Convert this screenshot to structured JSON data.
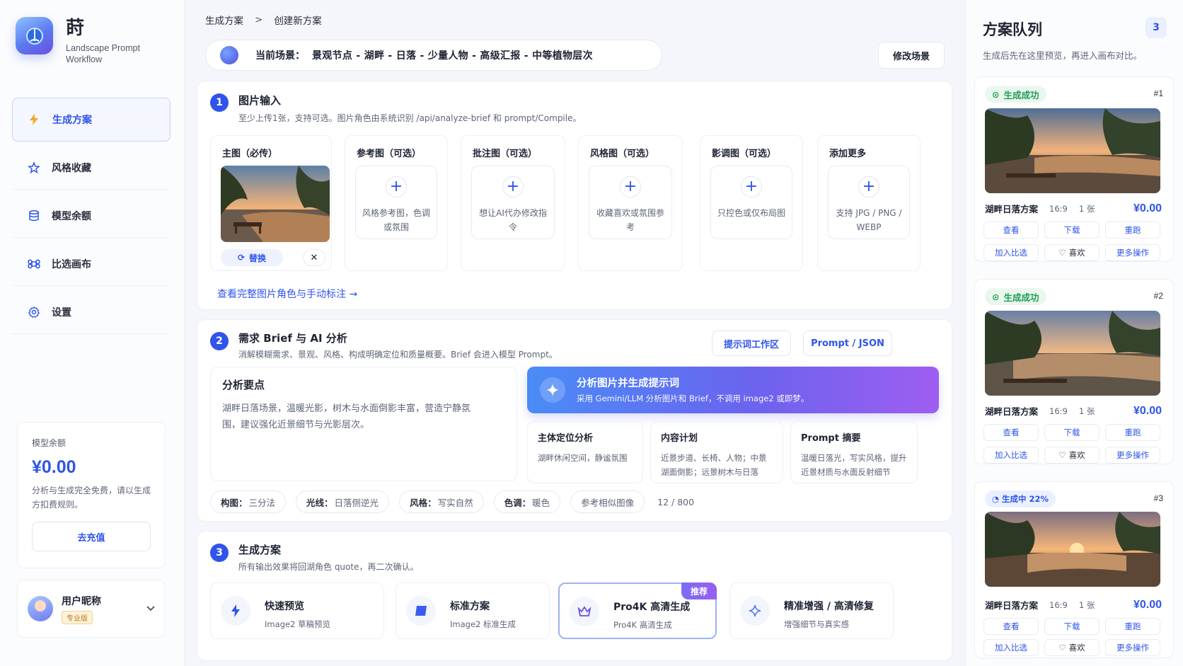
{
  "brand": {
    "title": "莳",
    "subtitle": "Landscape Prompt Workflow"
  },
  "nav": [
    {
      "label": "生成方案",
      "icon": "lightning-icon",
      "active": true
    },
    {
      "label": "风格收藏",
      "icon": "star-icon"
    },
    {
      "label": "模型余额",
      "icon": "database-icon"
    },
    {
      "label": "比选画布",
      "icon": "command-icon"
    },
    {
      "label": "设置",
      "icon": "gear-icon"
    }
  ],
  "balance": {
    "label": "模型余额",
    "value": "¥0.00",
    "note": "分析与生成完全免费，请以生成方扣费规则。",
    "recharge": "去充值"
  },
  "user": {
    "name": "用户昵称",
    "badge": "专业版"
  },
  "breadcrumb": {
    "root": "生成方案",
    "sep": ">",
    "current": "创建新方案"
  },
  "scene": {
    "label": "当前场景：",
    "value": "景观节点 - 湖畔 - 日落 - 少量人物 - 高级汇报 - 中等植物层次",
    "edit": "修改场景"
  },
  "section1": {
    "num": "1",
    "title": "图片输入",
    "desc": "至少上传1张，支持可选。图片角色由系统识别 /api/analyze-brief 和 prompt/Compile。",
    "slots": [
      {
        "title": "主图（必传）",
        "replace": "替换",
        "remove": "✕"
      },
      {
        "title": "参考图（可选）",
        "text": "风格参考图，色调或氛围"
      },
      {
        "title": "批注图（可选）",
        "text": "想让AI代办修改指令"
      },
      {
        "title": "风格图（可选）",
        "text": "收藏喜欢或氛围参考"
      },
      {
        "title": "影调图（可选）",
        "text": "只控色或仅布局图"
      },
      {
        "title": "添加更多",
        "text": "支持 JPG / PNG / WEBP"
      }
    ],
    "link": "查看完整图片角色与手动标注 →"
  },
  "section2": {
    "num": "2",
    "title": "需求 Brief 与 AI 分析",
    "desc": "消解模糊需求、景观、风格、构成明确定位和质量概要。Brief 会进入模型 Prompt。",
    "btn_workspace": "提示词工作区",
    "btn_json": "Prompt / JSON",
    "analysis_title": "分析要点",
    "analysis_text": "湖畔日落场景，温暖光影，树木与水面倒影丰富，营造宁静氛围，建议强化近景细节与光影层次。",
    "banner_title": "分析图片并生成提示词",
    "banner_sub": "采用 Gemini/LLM 分析图片和 Brief，不调用 image2 或即梦。",
    "cards": [
      {
        "title": "主体定位分析",
        "text": "湖畔休闲空间，静谧氛围"
      },
      {
        "title": "内容计划",
        "text": "近景步道、长椅、人物；中景湖面倒影；远景树木与日落"
      },
      {
        "title": "Prompt 摘要",
        "text": "温暖日落光，写实风格，提升近景材质与水面反射细节"
      }
    ],
    "tags": [
      {
        "k": "构图：",
        "v": "三分法"
      },
      {
        "k": "光线：",
        "v": "日落侧逆光"
      },
      {
        "k": "风格：",
        "v": "写实自然"
      },
      {
        "k": "色调：",
        "v": "暖色"
      },
      {
        "k": "",
        "v": "参考相似图像"
      }
    ],
    "counter": "12 / 800"
  },
  "section3": {
    "num": "3",
    "title": "生成方案",
    "desc": "所有输出效果将回湖角色 quote，再二次确认。",
    "options": [
      {
        "title": "快速预览",
        "sub": "Image2 草稿预览",
        "icon": "lightning-icon"
      },
      {
        "title": "标准方案",
        "sub": "Image2 标准生成",
        "icon": "square-icon"
      },
      {
        "title": "Pro4K 高清生成",
        "sub": "Pro4K 高清生成",
        "icon": "crown-icon",
        "badge": "推荐"
      },
      {
        "title": "精准增强 / 高清修复",
        "sub": "增强细节与真实感",
        "icon": "sparkle-icon"
      }
    ]
  },
  "queue": {
    "title": "方案队列",
    "count": "3",
    "sub": "生成后先在这里预览，再进入画布对比。",
    "items": [
      {
        "status": "生成成功",
        "idx": "#1",
        "name": "湖畔日落方案",
        "ratio": "16:9",
        "count": "1 张",
        "price": "¥0.00"
      },
      {
        "status": "生成成功",
        "idx": "#2",
        "name": "湖畔日落方案",
        "ratio": "16:9",
        "count": "1 张",
        "price": "¥0.00"
      },
      {
        "status": "生成中 22%",
        "idx": "#3",
        "name": "湖畔日落方案",
        "ratio": "16:9",
        "count": "1 张",
        "price": "¥0.00",
        "progress": 0.22
      }
    ],
    "actions": {
      "view": "查看",
      "download": "下载",
      "rerun": "重跑",
      "compare": "加入比选",
      "like": "喜欢",
      "more": "更多操作"
    }
  },
  "colors": {
    "accent": "#2f54eb",
    "success": "#1f9d55",
    "gradient_start": "#4a8cf7",
    "gradient_end": "#9f5ef0"
  }
}
